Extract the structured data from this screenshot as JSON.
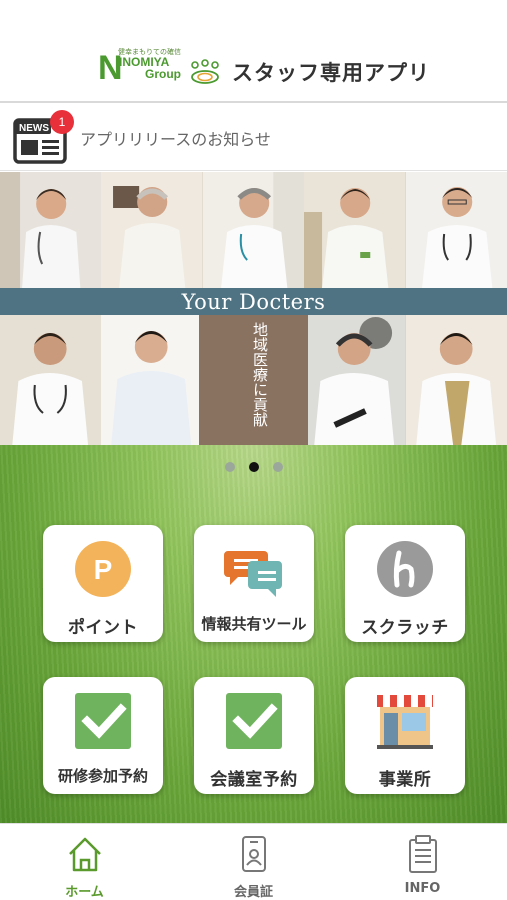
{
  "header": {
    "logo": {
      "tagline": "健幸まもりての確信",
      "brand_n": "N",
      "brand_rest": "INOMIYA",
      "brand_group": "Group"
    },
    "title": "スタッフ専用アプリ"
  },
  "news": {
    "badge_label": "NEWS",
    "badge_count": "1",
    "text": "アプリリリースのお知らせ",
    "icon": "newspaper-icon"
  },
  "banner": {
    "heading": "Your Docters",
    "vertical_text": "地域医療に貢献",
    "slide_index": 2,
    "slide_count": 3
  },
  "menu": [
    {
      "label": "ポイント",
      "icon": "point-coin-icon"
    },
    {
      "label": "情報共有ツール",
      "icon": "chat-bubbles-icon"
    },
    {
      "label": "スクラッチ",
      "icon": "scratch-coin-icon"
    },
    {
      "label": "研修参加予約",
      "icon": "checkbox-icon"
    },
    {
      "label": "会議室予約",
      "icon": "checkbox-icon"
    },
    {
      "label": "事業所",
      "icon": "storefront-icon"
    }
  ],
  "tabs": [
    {
      "label": "ホーム",
      "icon": "home-icon",
      "active": true
    },
    {
      "label": "会員証",
      "icon": "member-card-icon",
      "active": false
    },
    {
      "label": "INFO",
      "icon": "clipboard-icon",
      "active": false
    }
  ],
  "colors": {
    "brand_green": "#4b9a2f",
    "tab_active": "#5a9a2c",
    "badge_red": "#e8303a",
    "banner_strip": "#4f7382",
    "point_orange": "#f3b35a",
    "check_green": "#6fb35e"
  }
}
